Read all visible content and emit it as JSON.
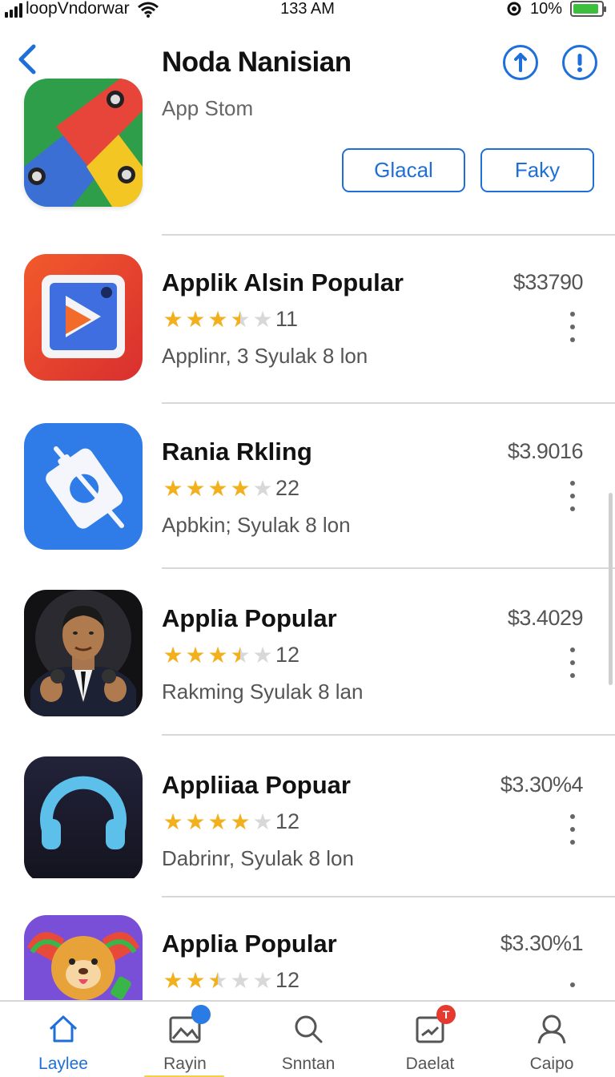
{
  "status_bar": {
    "carrier": "loopVndorwar",
    "time": "133 AM",
    "battery_percent": "10%",
    "battery_level": 0.9
  },
  "header": {
    "title": "Noda Nanisian",
    "subtitle": "App Stom",
    "button_left": "Glacal",
    "button_right": "Faky",
    "icon_button_1": "info-arrow-icon",
    "icon_button_2": "alert-icon"
  },
  "apps": [
    {
      "name": "Applik Alsin Popular",
      "price": "$33790",
      "rating": 3.5,
      "rating_count": "11",
      "meta": "Applinr, 3 Syulak 8 lon",
      "icon": "play-app-icon"
    },
    {
      "name": "Rania Rkling",
      "price": "$3.9016",
      "rating": 4.0,
      "rating_count": "22",
      "meta": "Apbkin; Syulak 8 lon",
      "icon": "tag-app-icon"
    },
    {
      "name": "Applia Popular",
      "price": "$3.4029",
      "rating": 3.5,
      "rating_count": "12",
      "meta": "Rakming Syulak 8 lan",
      "icon": "speaker-photo-icon"
    },
    {
      "name": "Appliiaa Popuar",
      "price": "$3.30%4",
      "rating": 4.0,
      "rating_count": "12",
      "meta": "Dabrinr, Syulak 8 lon",
      "icon": "headphones-app-icon"
    },
    {
      "name": "Applia Popular",
      "price": "$3.30%1",
      "rating": 2.5,
      "rating_count": "12",
      "meta": "",
      "icon": "lion-game-icon"
    }
  ],
  "tabs": [
    {
      "label": "Laylee",
      "icon": "home-icon",
      "active": true
    },
    {
      "label": "Rayin",
      "icon": "gallery-icon",
      "badge": "",
      "badge_color": "#2a7be4"
    },
    {
      "label": "Snntan",
      "icon": "search-icon"
    },
    {
      "label": "Daelat",
      "icon": "inbox-icon",
      "badge": "T",
      "badge_color": "#e53a2f"
    },
    {
      "label": "Caipo",
      "icon": "profile-icon"
    }
  ],
  "colors": {
    "accent": "#1e6fd9",
    "star": "#f2b01e"
  }
}
